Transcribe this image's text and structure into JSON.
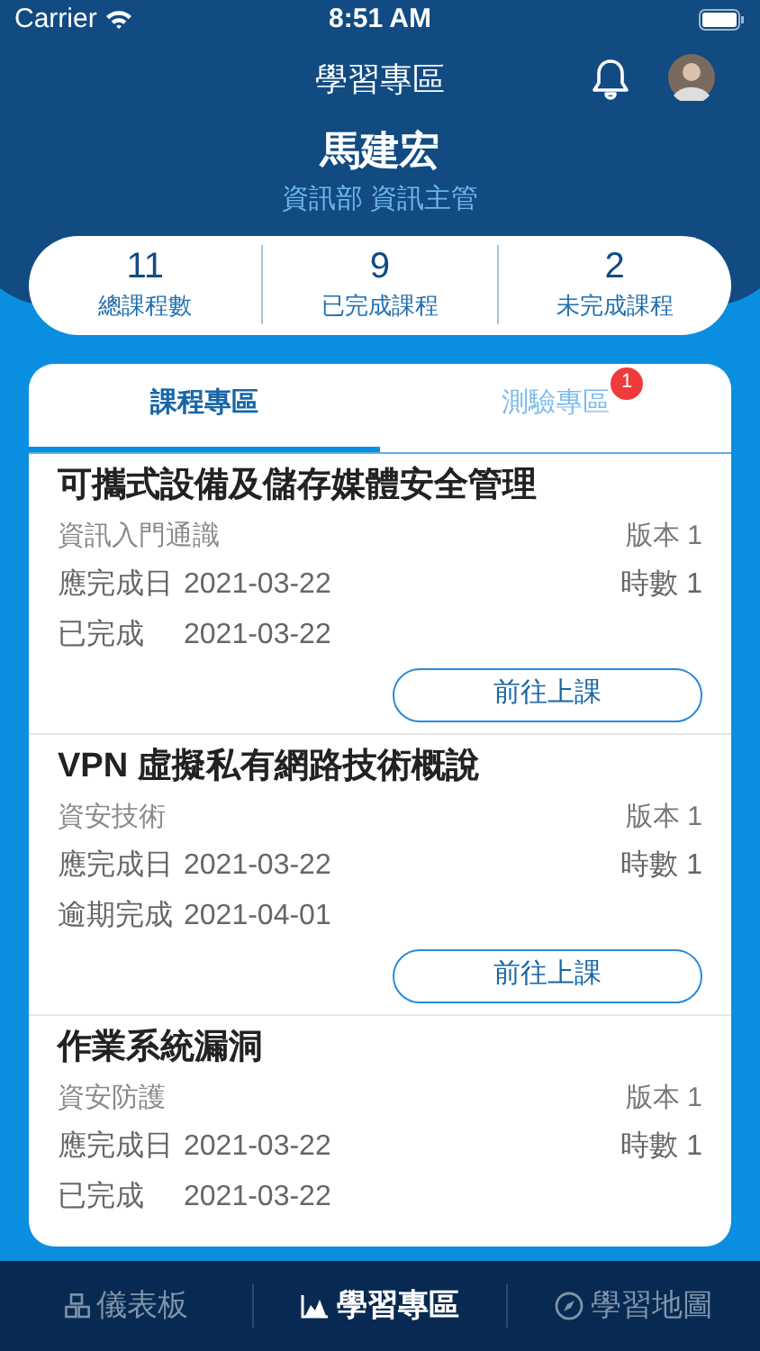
{
  "status_bar": {
    "carrier": "Carrier",
    "time": "8:51 AM"
  },
  "header": {
    "title": "學習專區"
  },
  "user": {
    "name": "馬建宏",
    "department": "資訊部 資訊主管"
  },
  "stats": [
    {
      "value": "11",
      "label": "總課程數"
    },
    {
      "value": "9",
      "label": "已完成課程"
    },
    {
      "value": "2",
      "label": "未完成課程"
    }
  ],
  "tabs": [
    {
      "label": "課程專區",
      "selected": true
    },
    {
      "label": "測驗專區",
      "selected": false,
      "badge": "1"
    }
  ],
  "courses": [
    {
      "title": "可攜式設備及儲存媒體安全管理",
      "category": "資訊入門通識",
      "version": "版本 1",
      "due_label": "應完成日",
      "due_date": "2021-03-22",
      "hours": "時數 1",
      "status_label": "已完成",
      "status_date": "2021-03-22",
      "button": "前往上課"
    },
    {
      "title": "VPN 虛擬私有網路技術概說",
      "category": "資安技術",
      "version": "版本 1",
      "due_label": "應完成日",
      "due_date": "2021-03-22",
      "hours": "時數 1",
      "status_label": "逾期完成",
      "status_date": "2021-04-01",
      "button": "前往上課"
    },
    {
      "title": "作業系統漏洞",
      "category": "資安防護",
      "version": "版本 1",
      "due_label": "應完成日",
      "due_date": "2021-03-22",
      "hours": "時數 1",
      "status_label": "已完成",
      "status_date": "2021-03-22"
    }
  ],
  "bottom_nav": [
    {
      "label": "儀表板",
      "kind": "grid",
      "selected": false
    },
    {
      "label": "學習專區",
      "kind": "chart",
      "selected": true
    },
    {
      "label": "學習地圖",
      "kind": "compass",
      "selected": false
    }
  ]
}
